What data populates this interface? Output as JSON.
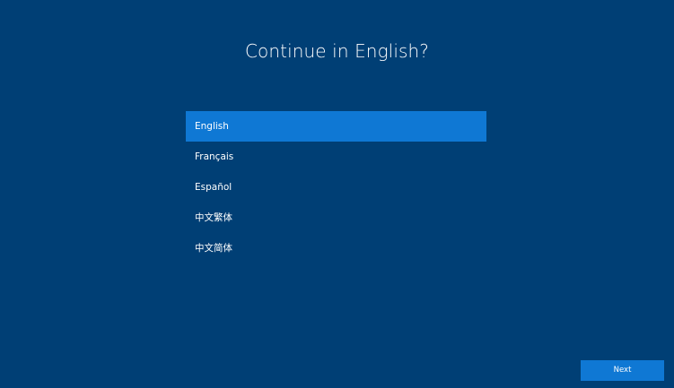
{
  "page": {
    "title": "Continue in English?"
  },
  "languages": {
    "selected": "English",
    "items": [
      {
        "label": "English"
      },
      {
        "label": "Français"
      },
      {
        "label": "Español"
      },
      {
        "label": "中文繁体"
      },
      {
        "label": "中文简体"
      }
    ]
  },
  "footer": {
    "next_label": "Next"
  },
  "colors": {
    "background": "#003f75",
    "accent": "#0f78d4",
    "text": "#ffffff"
  }
}
